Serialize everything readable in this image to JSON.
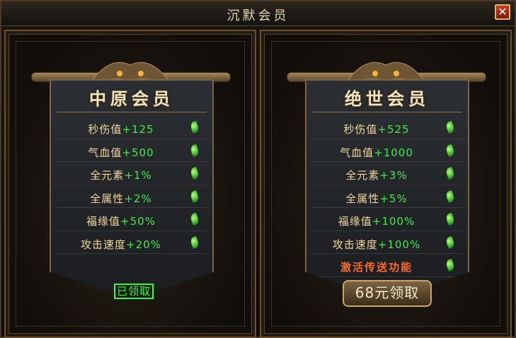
{
  "window": {
    "title": "沉默会员",
    "close_label": "✕"
  },
  "panels": [
    {
      "title": "中原会员",
      "stats": [
        {
          "name": "秒伤值",
          "value": "+125"
        },
        {
          "name": "气血值",
          "value": "+500"
        },
        {
          "name": "全元素",
          "value": "+1%"
        },
        {
          "name": "全属性",
          "value": "+2%"
        },
        {
          "name": "福缘值",
          "value": "+50%"
        },
        {
          "name": "攻击速度",
          "value": "+20%"
        }
      ],
      "status_label": "已领取"
    },
    {
      "title": "绝世会员",
      "stats": [
        {
          "name": "秒伤值",
          "value": "+525"
        },
        {
          "name": "气血值",
          "value": "+1000"
        },
        {
          "name": "全元素",
          "value": "+3%"
        },
        {
          "name": "全属性",
          "value": "+5%"
        },
        {
          "name": "福缘值",
          "value": "+100%"
        },
        {
          "name": "攻击速度",
          "value": "+100%"
        }
      ],
      "special_text": "激活传送功能",
      "button_label": "68元领取"
    }
  ],
  "colors": {
    "stat_name": "#f0d79e",
    "stat_value": "#40e84c",
    "special": "#ff6a26",
    "received": "#3dff3d"
  },
  "icons": {
    "stat_icon": "leaf-icon",
    "ornament": "dragon-ornament-icon"
  }
}
